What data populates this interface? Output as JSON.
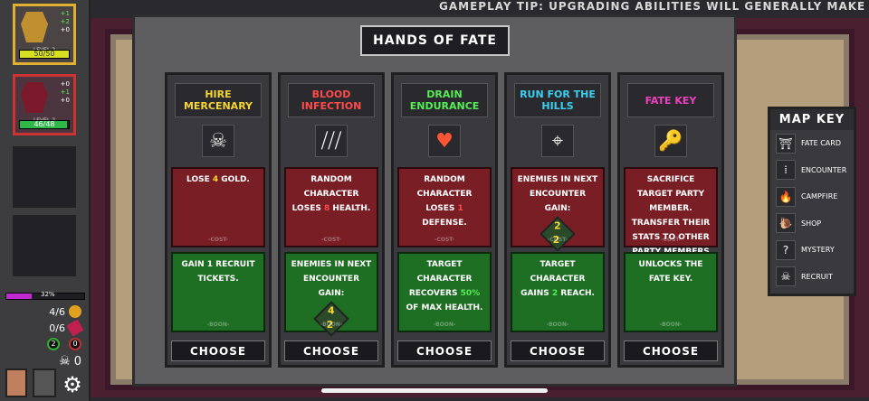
{
  "tip": "GAMEPLAY TIP: UPGRADING ABILITIES WILL GENERALLY MAKE YOUR CHAR",
  "party": [
    {
      "level": "LEVEL 2",
      "hp": "50/50",
      "hp_fraction": 1.0,
      "bar_color": "#d6e020",
      "stats": [
        "+1",
        "+2",
        "+0"
      ]
    },
    {
      "level": "LEVEL 2",
      "hp": "46/48",
      "hp_fraction": 0.96,
      "bar_color": "#2fb84a",
      "stats": [
        "+0",
        "+1",
        "+0"
      ]
    }
  ],
  "xp_percent": "32%",
  "resources": [
    {
      "value": "4/6",
      "color": "#e0a020"
    },
    {
      "value": "0/6",
      "color": "#c02050"
    },
    {
      "value": "2",
      "color": "#30b030"
    },
    {
      "value": "0",
      "color": "#c03030"
    },
    {
      "value": "0",
      "color": "#ffffff"
    }
  ],
  "map_key": {
    "title": "MAP KEY",
    "items": [
      {
        "label": "FATE CARD",
        "icon": "fate-card-icon",
        "glyph": "⛩"
      },
      {
        "label": "ENCOUNTER",
        "icon": "encounter-icon",
        "glyph": "⁞"
      },
      {
        "label": "CAMPFIRE",
        "icon": "campfire-icon",
        "glyph": "🔥"
      },
      {
        "label": "SHOP",
        "icon": "shop-icon",
        "glyph": "🐌"
      },
      {
        "label": "MYSTERY",
        "icon": "mystery-icon",
        "glyph": "?"
      },
      {
        "label": "RECRUIT",
        "icon": "recruit-icon",
        "glyph": "☠"
      }
    ]
  },
  "modal": {
    "title": "HANDS OF FATE",
    "cost_label": "-COST-",
    "boon_label": "-BOON-",
    "choose_label": "CHOOSE",
    "cards": [
      {
        "name": "HIRE MERCENARY",
        "color": "#f5d530",
        "icon": "skeleton-icon",
        "glyph": "☠",
        "cost": [
          "LOSE ",
          "4",
          " GOLD."
        ],
        "cost_hl": "y",
        "boon": [
          "GAIN 1 RECRUIT TICKETS.",
          "",
          ""
        ],
        "boon_hl": "g"
      },
      {
        "name": "BLOOD INFECTION",
        "color": "#ff4a4a",
        "icon": "claw-slash-icon",
        "glyph": "⧸⧸⧸",
        "cost": [
          "RANDOM CHARACTER LOSES ",
          "8",
          " HEALTH."
        ],
        "cost_hl": "r",
        "boon": [
          "ENEMIES IN NEXT ENCOUNTER GAIN:",
          "",
          ""
        ],
        "boon_hl": "g",
        "boon_die": [
          "4",
          "2"
        ]
      },
      {
        "name": "DRAIN ENDURANCE",
        "color": "#55ee55",
        "icon": "broken-heart-icon",
        "glyph": "♥",
        "cost": [
          "RANDOM CHARACTER LOSES ",
          "1",
          " DEFENSE."
        ],
        "cost_hl": "r",
        "boon": [
          "TARGET CHARACTER RECOVERS ",
          "50%",
          " OF MAX HEALTH."
        ],
        "boon_hl": "g"
      },
      {
        "name": "RUN FOR THE HILLS",
        "color": "#39d0f0",
        "icon": "crosshair-icon",
        "glyph": "⌖",
        "cost": [
          "ENEMIES IN NEXT ENCOUNTER GAIN:",
          "",
          ""
        ],
        "cost_hl": "r",
        "cost_die": [
          "2",
          "2"
        ],
        "boon": [
          "TARGET CHARACTER GAINS ",
          "2",
          " REACH."
        ],
        "boon_hl": "g"
      },
      {
        "name": "FATE KEY",
        "color": "#f040c0",
        "icon": "key-icon",
        "glyph": "🔑",
        "cost": [
          "SACRIFICE TARGET PARTY MEMBER. TRANSFER THEIR STATS TO OTHER PARTY MEMBERS RANDOMLY.",
          "",
          ""
        ],
        "cost_hl": "r",
        "boon": [
          "UNLOCKS THE FATE KEY.",
          "",
          ""
        ],
        "boon_hl": "g"
      }
    ]
  }
}
